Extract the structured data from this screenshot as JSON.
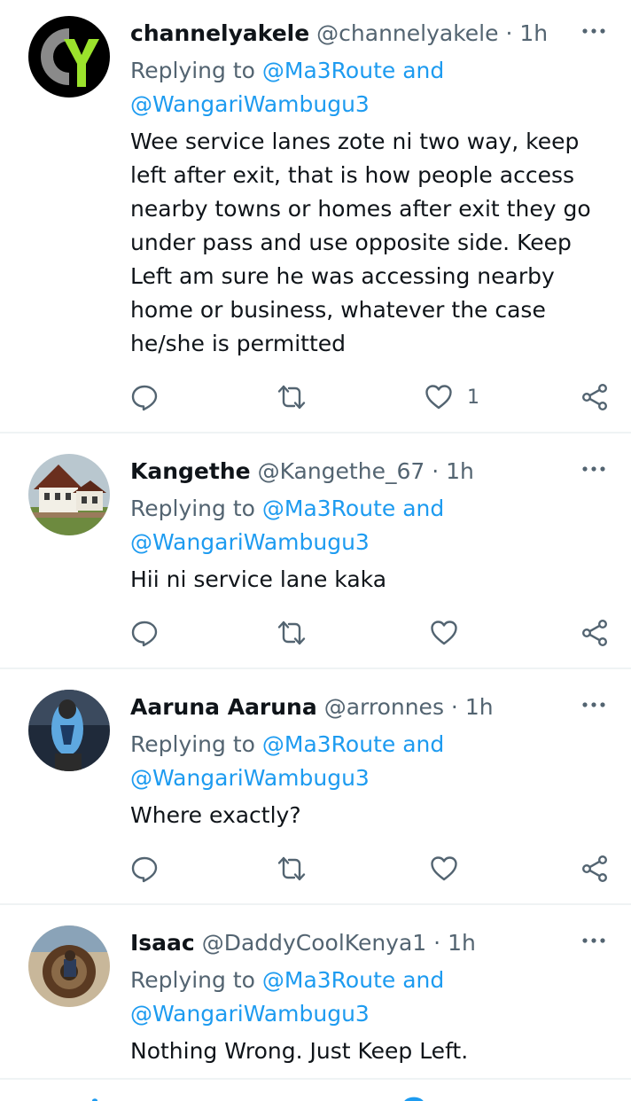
{
  "colors": {
    "accent": "#1d9bf0",
    "text": "#0f1419",
    "muted": "#536471",
    "divider": "#eff3f4"
  },
  "icons": {
    "reply": "speech-bubble-icon",
    "retweet": "retweet-arrows-icon",
    "like": "heart-icon",
    "share": "share-icon",
    "more": "more-dots-icon"
  },
  "tweets": [
    {
      "name": "channelyakele",
      "handle": "@channelyakele",
      "dot": "·",
      "time": "1h",
      "replying_prefix": "Replying to ",
      "mention_line1": "@Ma3Route and",
      "mention_line2": "@WangariWambugu3",
      "text": "Wee service lanes zote ni two way, keep left after exit, that is how people access nearby towns or homes after exit they go under pass and use opposite side. Keep Left am sure he was accessing nearby home or business, whatever the case he/she is permitted",
      "likes": "1"
    },
    {
      "name": "Kangethe",
      "handle": "@Kangethe_67",
      "dot": "·",
      "time": "1h",
      "replying_prefix": "Replying to ",
      "mention_line1": "@Ma3Route and",
      "mention_line2": "@WangariWambugu3",
      "text": "Hii ni service lane kaka",
      "likes": ""
    },
    {
      "name": "Aaruna Aaruna",
      "handle": "@arronnes",
      "dot": "·",
      "time": "1h",
      "replying_prefix": "Replying to ",
      "mention_line1": "@Ma3Route and",
      "mention_line2": "@WangariWambugu3",
      "text": "Where exactly?",
      "likes": ""
    },
    {
      "name": "Isaac",
      "handle": "@DaddyCoolKenya1",
      "dot": "·",
      "time": "1h",
      "replying_prefix": "Replying to ",
      "mention_line1": "@Ma3Route and",
      "mention_line2": "@WangariWambugu3",
      "text": "Nothing Wrong. Just Keep Left.",
      "likes": ""
    }
  ]
}
